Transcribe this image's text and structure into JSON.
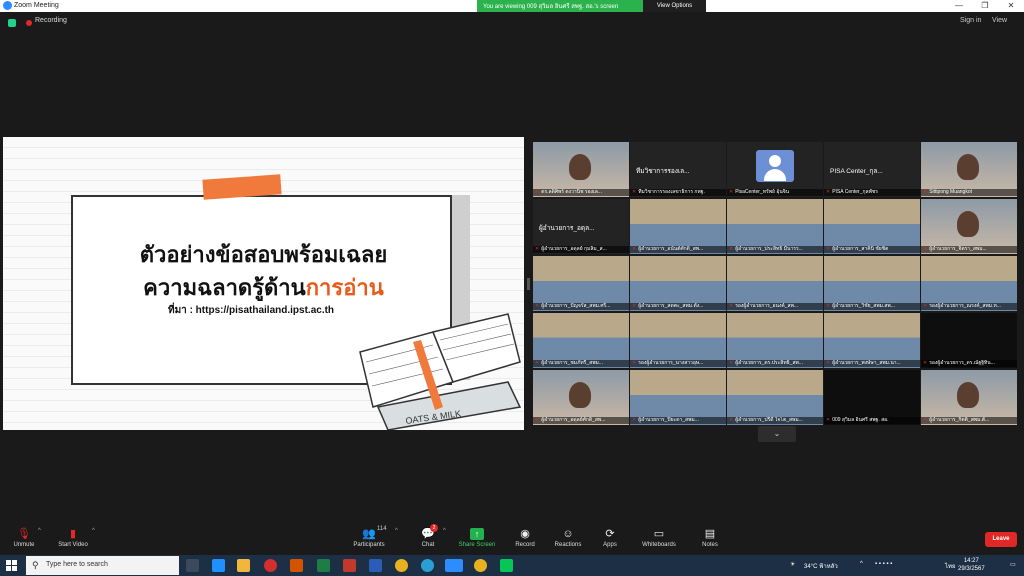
{
  "window": {
    "title": "Zoom Meeting"
  },
  "banner": {
    "text": "You are viewing 009 สุวิมล อินศรี สพฐ. สอ.'s screen",
    "view_options": "View Options"
  },
  "topbar": {
    "recording": "Recording",
    "sign_in": "Sign in",
    "view": "View"
  },
  "slide": {
    "line1": "ตัวอย่างข้อสอบพร้อมเฉลย",
    "line2_prefix": "ความฉลาดรู้ด้าน",
    "line2_highlight": "การอ่าน",
    "source": "ที่มา : https://pisathailand.ipst.ac.th",
    "book_label": "OATS & MILK"
  },
  "gallery": [
    {
      "name": "ดร.ลดิศิพร์ ดงวานิช รองเล...",
      "kind": "person",
      "active": true
    },
    {
      "name": "ทีมวิชาการรองเลขาธิการ กพฐ.",
      "kind": "name",
      "big": "ทีมวิชาการรองเล..."
    },
    {
      "name": "PisaCenter_ทรัพย์ อุ้นจิน",
      "kind": "avatar"
    },
    {
      "name": "PISA Center_กุลพัชร",
      "kind": "name",
      "big": "PISA Center_กุล..."
    },
    {
      "name": "Sittipong Muangkot",
      "kind": "person"
    },
    {
      "name": "ผู้อำนวยการ_อดุลย์ กุมลิ้ม_ส...",
      "kind": "name",
      "big": "ผู้อำนวยการ_อดุล..."
    },
    {
      "name": "ผู้อำนวยการ_อนันต์ศักดิ์_สพ...",
      "kind": "room"
    },
    {
      "name": "ผู้อำนวยการ_ประสิทธิ์ มีนารร...",
      "kind": "room"
    },
    {
      "name": "ผู้อำนวยการ_สาคินิ ชัยชิต",
      "kind": "room"
    },
    {
      "name": "ผู้อำนวยการ_จิตรา_สพม...",
      "kind": "person"
    },
    {
      "name": "ผู้อำนวยการ_ปัญจรัส_สพม.ศรี...",
      "kind": "room"
    },
    {
      "name": "ผู้อำนวยการ_สดตะ_สพม.ตัง...",
      "kind": "room"
    },
    {
      "name": "รองผู้อำนวยการ_อนงค์_สพ...",
      "kind": "room"
    },
    {
      "name": "ผู้อำนวยการ_วิชัย_สพม.สพ...",
      "kind": "room"
    },
    {
      "name": "รองผู้อำนวยการ_ณรงค์_สพม.ห...",
      "kind": "room"
    },
    {
      "name": "ผู้อำนวยการ_ชมภัทรี_สพม...",
      "kind": "room"
    },
    {
      "name": "รองผู้อำนวยการ_นางสาวอุษ...",
      "kind": "room"
    },
    {
      "name": "ผู้อำนวยการ_ดร.ประสิทธิ์_สพ...",
      "kind": "room"
    },
    {
      "name": "ผู้อำนวยการ_พงษ์ษา_สพม.นา...",
      "kind": "room"
    },
    {
      "name": "รองผู้อำนวยการ_ดร.ณัฐฐิ์ทิน...",
      "kind": "dark"
    },
    {
      "name": "ผู้อำนวยการ_อดุลย์ศักดิ์_สพ...",
      "kind": "person"
    },
    {
      "name": "ผู้อำนวยการ_ปิยะดา_สพม...",
      "kind": "room"
    },
    {
      "name": "ผู้อำนวยการ_ปรีดี ใจโต_สพม...",
      "kind": "room"
    },
    {
      "name": "009 สุวิมล อินศรี สพฐ. สอ.",
      "kind": "dark"
    },
    {
      "name": "ผู้อำนวยการ_กิตติ_สพม.ตั...",
      "kind": "person"
    }
  ],
  "toolbar": {
    "unmute": "Unmute",
    "start_video": "Start Video",
    "participants": "Participants",
    "participants_count": "114",
    "chat": "Chat",
    "chat_badge": "2",
    "share_screen": "Share Screen",
    "record": "Record",
    "reactions": "Reactions",
    "apps": "Apps",
    "whiteboards": "Whiteboards",
    "notes": "Notes",
    "leave": "Leave"
  },
  "taskbar": {
    "search_placeholder": "Type here to search",
    "weather": "34°C ฟ้าหลัว",
    "lang": "ไทย",
    "time": "14:27",
    "date": "29/3/2567"
  },
  "colors": {
    "accent_orange": "#e85a1c",
    "active_speaker": "#e3d33c",
    "leave_red": "#e02828",
    "share_green": "#23b14d"
  }
}
